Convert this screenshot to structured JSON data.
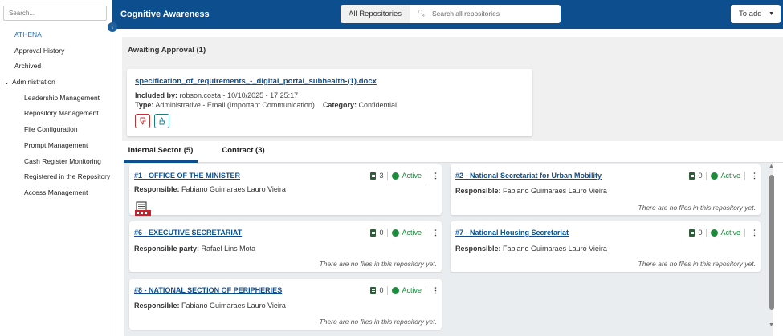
{
  "sidebar": {
    "search_placeholder": "Search...",
    "brand": "ATHENA",
    "items": [
      {
        "label": "Approval History"
      },
      {
        "label": "Archived"
      }
    ],
    "group": {
      "label": "Administration",
      "items": [
        {
          "label": "Leadership Management"
        },
        {
          "label": "Repository Management"
        },
        {
          "label": "File Configuration"
        },
        {
          "label": "Prompt Management"
        },
        {
          "label": "Cash Register Monitoring"
        },
        {
          "label": "Registered in the Repository"
        },
        {
          "label": "Access Management"
        }
      ]
    }
  },
  "header": {
    "title": "Cognitive Awareness",
    "repo_select": "All Repositories",
    "search_placeholder": "Search all repositories",
    "add_button": "To add"
  },
  "awaiting": {
    "heading": "Awaiting Approval (1)",
    "card": {
      "document": "specification_of_requirements_-_digital_portal_subhealth-(1).docx",
      "included_by_label": "Included by:",
      "included_by_value": "robson.costa - 10/10/2025 - 17:25:17",
      "type_label": "Type:",
      "type_value": "Administrative - Email (Important Communication)",
      "category_label": "Category:",
      "category_value": "Confidential"
    }
  },
  "tabs": [
    {
      "label": "Internal Sector (5)",
      "active": true
    },
    {
      "label": "Contract (3)",
      "active": false
    }
  ],
  "repositories": [
    {
      "name": "#1 - OFFICE OF THE MINISTER",
      "files": "3",
      "status": "Active",
      "resp_label": "Responsible:",
      "resp_value": "Fabiano Guimaraes Lauro Vieira",
      "empty": ""
    },
    {
      "name": "#2 - National Secretariat for Urban Mobility",
      "files": "0",
      "status": "Active",
      "resp_label": "Responsible:",
      "resp_value": "Fabiano Guimaraes Lauro Vieira",
      "empty": "There are no files in this repository yet."
    },
    {
      "name": "#6 - EXECUTIVE SECRETARIAT",
      "files": "0",
      "status": "Active",
      "resp_label": "Responsible party:",
      "resp_value": "Rafael Lins Mota",
      "empty": "There are no files in this repository yet."
    },
    {
      "name": "#7 - National Housing Secretariat",
      "files": "0",
      "status": "Active",
      "resp_label": "Responsible:",
      "resp_value": "Fabiano Guimaraes Lauro Vieira",
      "empty": "There are no files in this repository yet."
    },
    {
      "name": "#8 - NATIONAL SECTION OF PERIPHERIES",
      "files": "0",
      "status": "Active",
      "resp_label": "Responsible:",
      "resp_value": "Fabiano Guimaraes Lauro Vieira",
      "empty": "There are no files in this repository yet."
    }
  ],
  "colors": {
    "header_bg": "#0d4e8f",
    "active_green": "#1d8a3c",
    "link_blue": "#0d4e8f"
  }
}
